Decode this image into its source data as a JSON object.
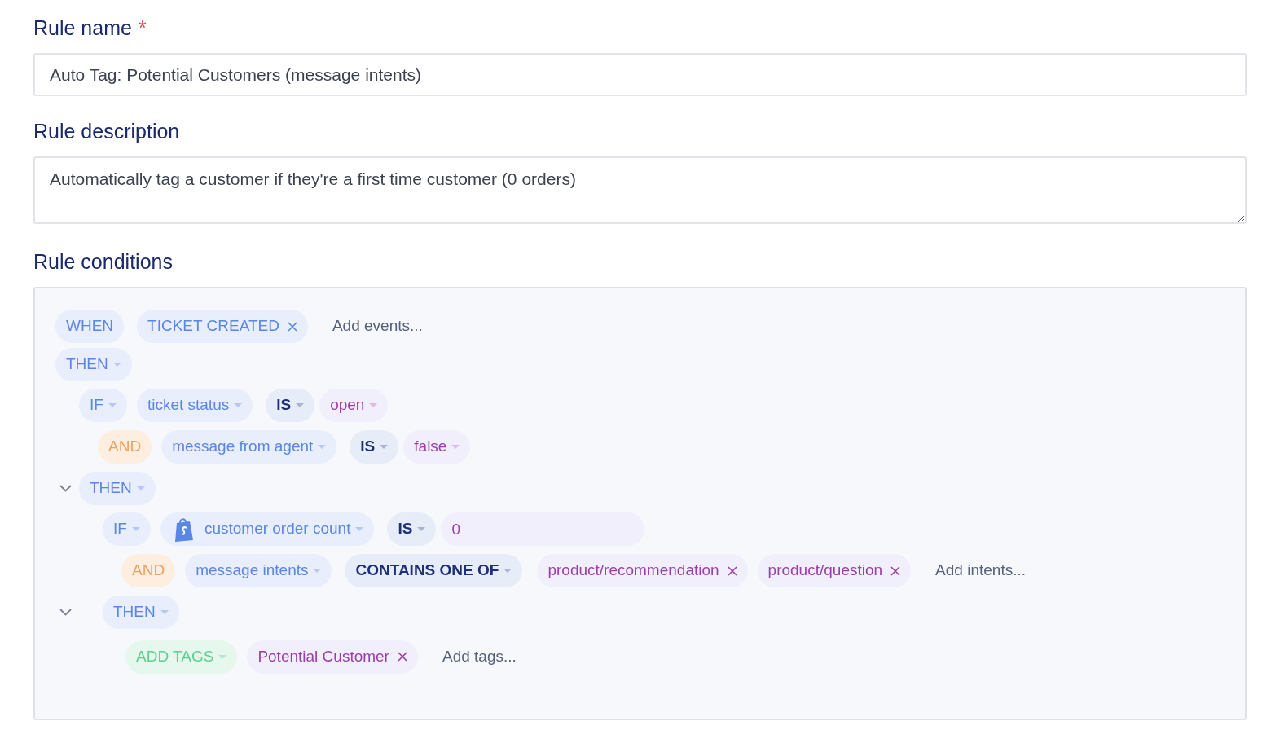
{
  "rule_name": {
    "label": "Rule name",
    "required_mark": "*",
    "value": "Auto Tag: Potential Customers (message intents)"
  },
  "rule_description": {
    "label": "Rule description",
    "value": "Automatically tag a customer if they're a first time customer (0 orders)"
  },
  "rule_conditions": {
    "label": "Rule conditions",
    "trigger": {
      "keyword": "WHEN",
      "events": [
        "TICKET CREATED"
      ],
      "placeholder": "Add events..."
    },
    "branch": {
      "keyword": "THEN",
      "chevron": false,
      "conditions": [
        {
          "kind": "if",
          "keyword": "IF",
          "field": "ticket status",
          "shop_icon": false,
          "operator": "IS",
          "value": {
            "kind": "select",
            "text": "open"
          }
        },
        {
          "kind": "and",
          "keyword": "AND",
          "field": "message from agent",
          "shop_icon": false,
          "operator": "IS",
          "value": {
            "kind": "select",
            "text": "false"
          }
        }
      ],
      "children": [
        {
          "keyword": "THEN",
          "chevron": true,
          "conditions": [
            {
              "kind": "if",
              "keyword": "IF",
              "field": "customer order count",
              "shop_icon": true,
              "operator": "IS",
              "value": {
                "kind": "input",
                "text": "0"
              }
            },
            {
              "kind": "and",
              "keyword": "AND",
              "field": "message intents",
              "shop_icon": false,
              "operator": "CONTAINS ONE OF",
              "value": {
                "kind": "tags",
                "tags": [
                  "product/recommendation",
                  "product/question"
                ],
                "placeholder": "Add intents..."
              }
            }
          ],
          "children": [
            {
              "keyword": "THEN",
              "chevron": true,
              "action": {
                "keyword": "ADD TAGS",
                "tags": [
                  "Potential Customer"
                ],
                "placeholder": "Add tags..."
              }
            }
          ]
        }
      ]
    }
  }
}
